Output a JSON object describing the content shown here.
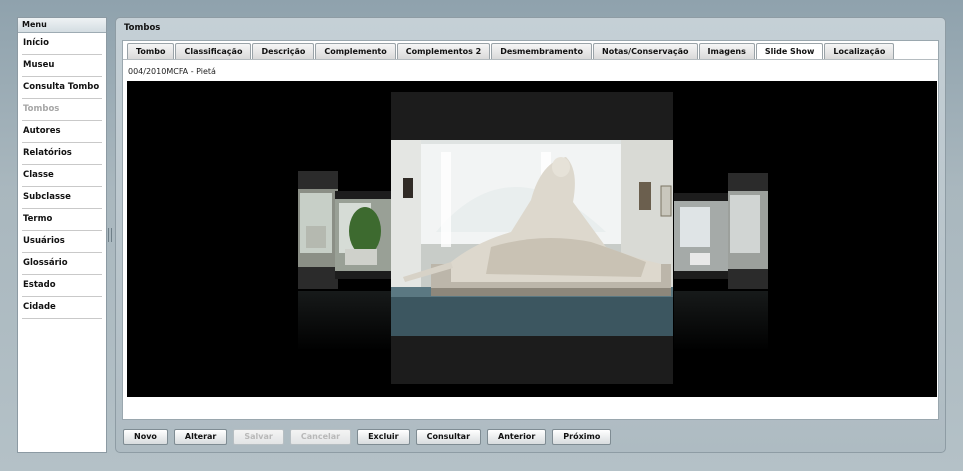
{
  "menu": {
    "title": "Menu",
    "items": [
      {
        "label": "Início",
        "enabled": true
      },
      {
        "label": "Museu",
        "enabled": true
      },
      {
        "label": "Consulta Tombo",
        "enabled": true
      },
      {
        "label": "Tombos",
        "enabled": false
      },
      {
        "label": "Autores",
        "enabled": true
      },
      {
        "label": "Relatórios",
        "enabled": true
      },
      {
        "label": "Classe",
        "enabled": true
      },
      {
        "label": "Subclasse",
        "enabled": true
      },
      {
        "label": "Termo",
        "enabled": true
      },
      {
        "label": "Usuários",
        "enabled": true
      },
      {
        "label": "Glossário",
        "enabled": true
      },
      {
        "label": "Estado",
        "enabled": true
      },
      {
        "label": "Cidade",
        "enabled": true
      }
    ]
  },
  "panel": {
    "title": "Tombos",
    "tabs": [
      "Tombo",
      "Classificação",
      "Descrição",
      "Complemento",
      "Complementos 2",
      "Desmembramento",
      "Notas/Conservação",
      "Imagens",
      "Slide Show",
      "Localização"
    ],
    "active_tab": "Slide Show",
    "record_title": "004/2010MCFA - Pietá"
  },
  "toolbar": {
    "buttons": [
      {
        "label": "Novo",
        "enabled": true
      },
      {
        "label": "Alterar",
        "enabled": true
      },
      {
        "label": "Salvar",
        "enabled": false
      },
      {
        "label": "Cancelar",
        "enabled": false
      },
      {
        "label": "Excluir",
        "enabled": true
      },
      {
        "label": "Consultar",
        "enabled": true
      },
      {
        "label": "Anterior",
        "enabled": true
      },
      {
        "label": "Próximo",
        "enabled": true
      }
    ]
  }
}
